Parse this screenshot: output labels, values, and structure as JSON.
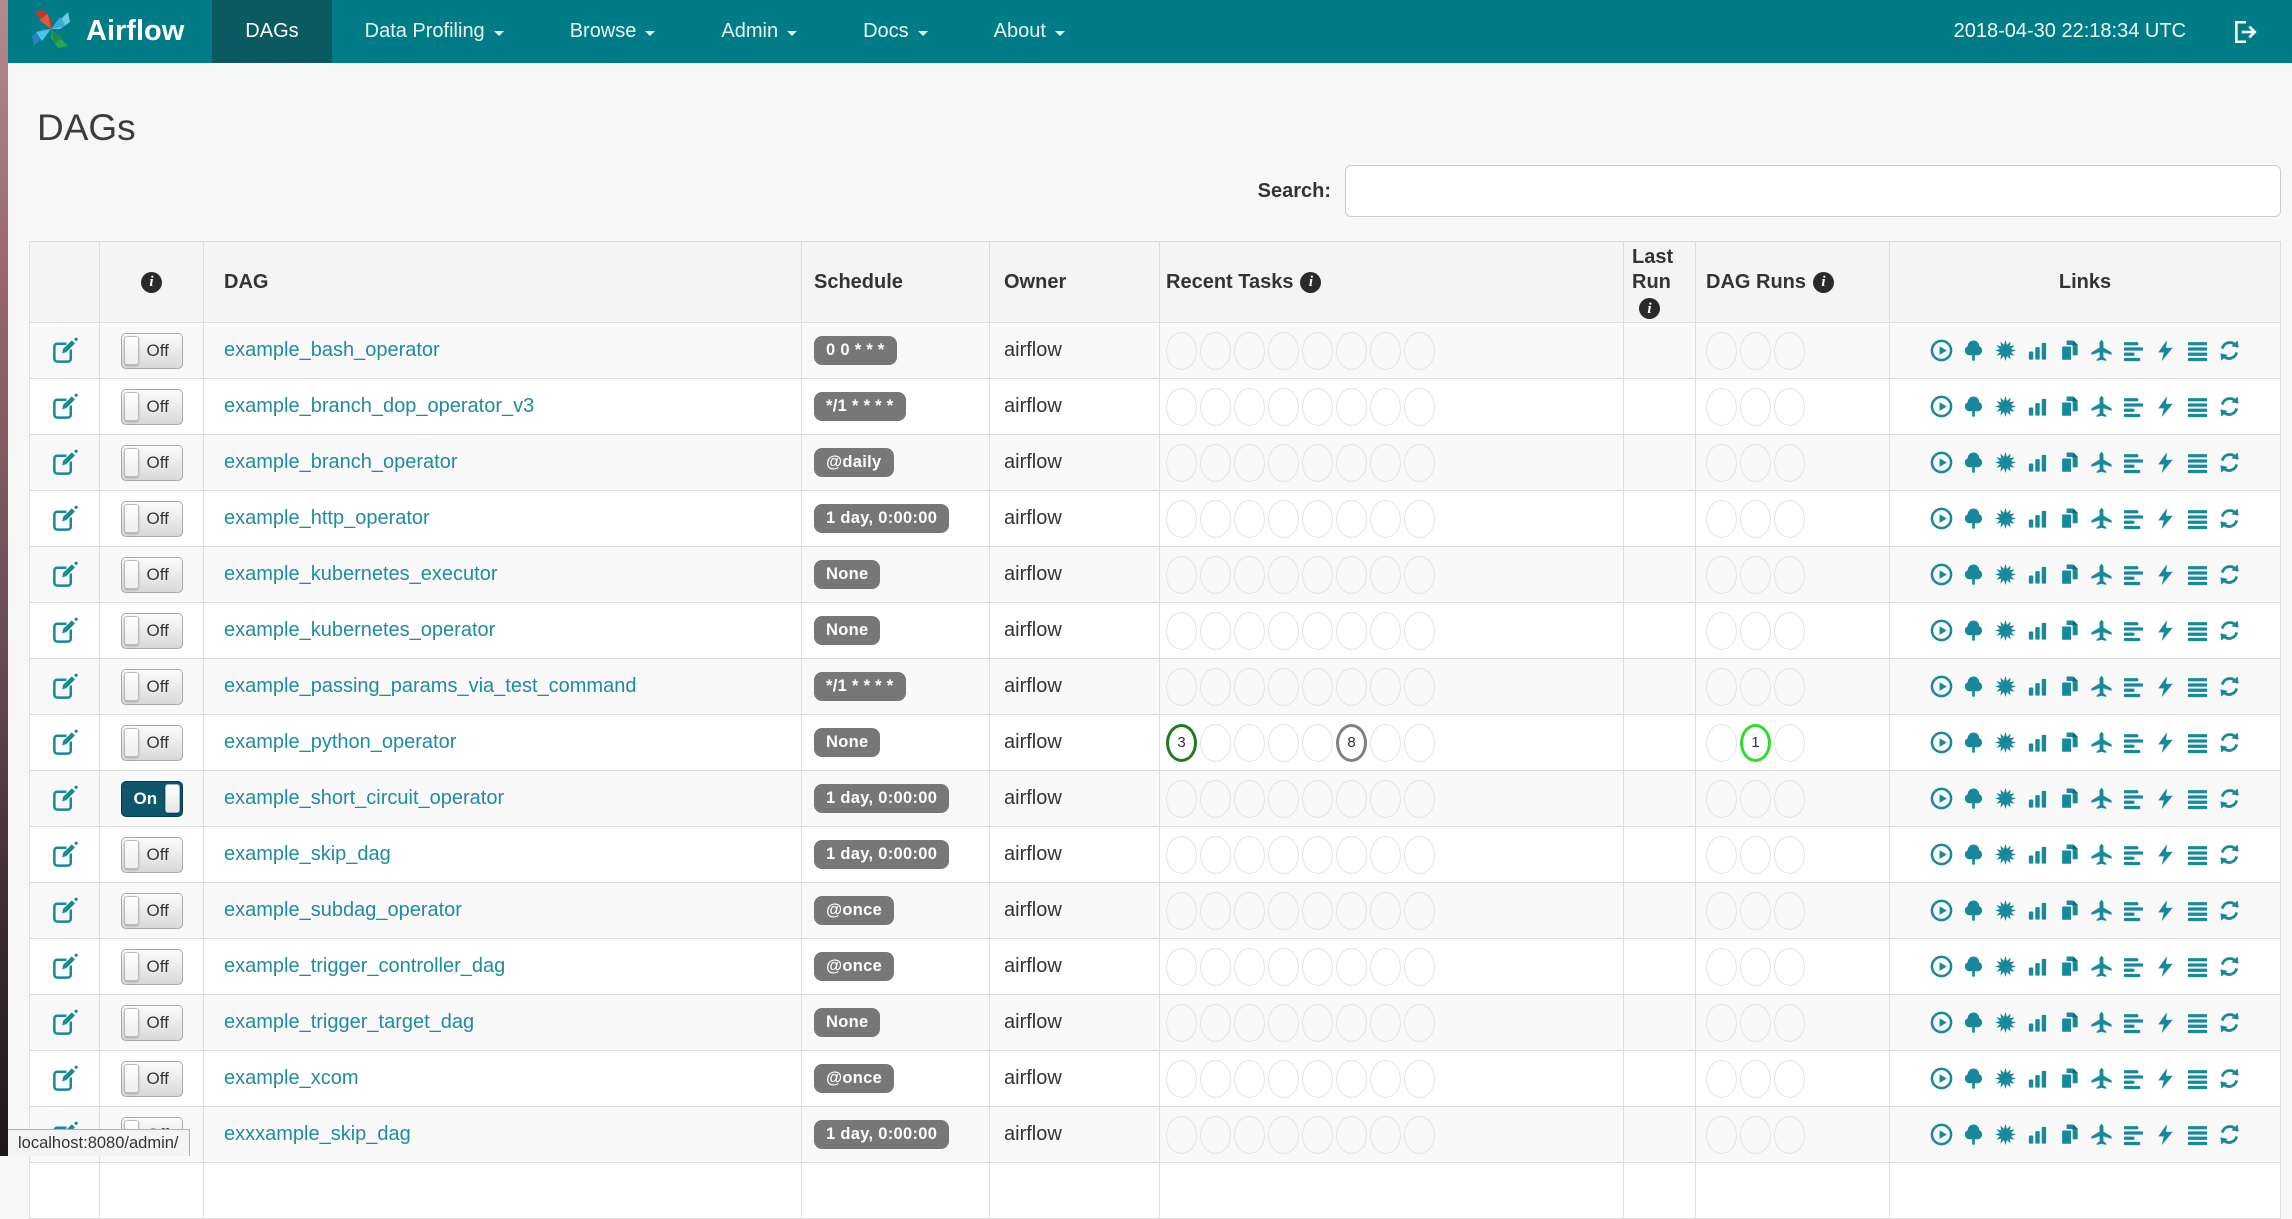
{
  "navbar": {
    "brand": "Airflow",
    "items": [
      {
        "label": "DAGs",
        "active": true,
        "dropdown": false
      },
      {
        "label": "Data Profiling",
        "active": false,
        "dropdown": true
      },
      {
        "label": "Browse",
        "active": false,
        "dropdown": true
      },
      {
        "label": "Admin",
        "active": false,
        "dropdown": true
      },
      {
        "label": "Docs",
        "active": false,
        "dropdown": true
      },
      {
        "label": "About",
        "active": false,
        "dropdown": true
      }
    ],
    "clock": "2018-04-30 22:18:34 UTC",
    "logout_icon": "sign-out-icon"
  },
  "page": {
    "title": "DAGs",
    "search_label": "Search:",
    "search_value": "",
    "status_bar_url": "localhost:8080/admin/"
  },
  "table": {
    "headers": {
      "edit": "",
      "info_glyph": "i",
      "dag": "DAG",
      "schedule": "Schedule",
      "owner": "Owner",
      "recent_tasks": "Recent Tasks",
      "last_run_line1": "Last",
      "last_run_line2": "Run",
      "dag_runs": "DAG Runs",
      "links": "Links"
    },
    "recent_task_slots": 8,
    "dag_run_slots": 3,
    "rows": [
      {
        "dag": "example_bash_operator",
        "toggle": "Off",
        "schedule": "0 0 * * *",
        "owner": "airflow",
        "recent_tasks": [],
        "dag_runs": []
      },
      {
        "dag": "example_branch_dop_operator_v3",
        "toggle": "Off",
        "schedule": "*/1 * * * *",
        "owner": "airflow",
        "recent_tasks": [],
        "dag_runs": []
      },
      {
        "dag": "example_branch_operator",
        "toggle": "Off",
        "schedule": "@daily",
        "owner": "airflow",
        "recent_tasks": [],
        "dag_runs": []
      },
      {
        "dag": "example_http_operator",
        "toggle": "Off",
        "schedule": "1 day, 0:00:00",
        "owner": "airflow",
        "recent_tasks": [],
        "dag_runs": []
      },
      {
        "dag": "example_kubernetes_executor",
        "toggle": "Off",
        "schedule": "None",
        "owner": "airflow",
        "recent_tasks": [],
        "dag_runs": []
      },
      {
        "dag": "example_kubernetes_operator",
        "toggle": "Off",
        "schedule": "None",
        "owner": "airflow",
        "recent_tasks": [],
        "dag_runs": []
      },
      {
        "dag": "example_passing_params_via_test_command",
        "toggle": "Off",
        "schedule": "*/1 * * * *",
        "owner": "airflow",
        "recent_tasks": [],
        "dag_runs": []
      },
      {
        "dag": "example_python_operator",
        "toggle": "Off",
        "schedule": "None",
        "owner": "airflow",
        "recent_tasks": [
          {
            "slot": 0,
            "count": "3",
            "color": "#217a21"
          },
          {
            "slot": 5,
            "count": "8",
            "color": "#808080"
          }
        ],
        "dag_runs": [
          {
            "slot": 1,
            "count": "1",
            "color": "#2ddc2d"
          }
        ]
      },
      {
        "dag": "example_short_circuit_operator",
        "toggle": "On",
        "schedule": "1 day, 0:00:00",
        "owner": "airflow",
        "recent_tasks": [],
        "dag_runs": []
      },
      {
        "dag": "example_skip_dag",
        "toggle": "Off",
        "schedule": "1 day, 0:00:00",
        "owner": "airflow",
        "recent_tasks": [],
        "dag_runs": []
      },
      {
        "dag": "example_subdag_operator",
        "toggle": "Off",
        "schedule": "@once",
        "owner": "airflow",
        "recent_tasks": [],
        "dag_runs": []
      },
      {
        "dag": "example_trigger_controller_dag",
        "toggle": "Off",
        "schedule": "@once",
        "owner": "airflow",
        "recent_tasks": [],
        "dag_runs": []
      },
      {
        "dag": "example_trigger_target_dag",
        "toggle": "Off",
        "schedule": "None",
        "owner": "airflow",
        "recent_tasks": [],
        "dag_runs": []
      },
      {
        "dag": "example_xcom",
        "toggle": "Off",
        "schedule": "@once",
        "owner": "airflow",
        "recent_tasks": [],
        "dag_runs": []
      },
      {
        "dag": "exxxample_skip_dag",
        "toggle": "Off",
        "schedule": "1 day, 0:00:00",
        "owner": "airflow",
        "recent_tasks": [],
        "dag_runs": []
      }
    ],
    "link_icons": [
      "trigger-dag-play-icon",
      "tree-view-icon",
      "graph-view-sunburst-icon",
      "task-duration-chart-icon",
      "task-tries-pages-icon",
      "landing-times-plane-icon",
      "gantt-chart-icon",
      "code-bolt-icon",
      "dag-details-list-icon",
      "refresh-icon"
    ]
  },
  "colors": {
    "navbar_bg": "#007c87",
    "navbar_active_bg": "#0b5961",
    "link_teal": "#1e8ca0",
    "icon_teal": "#17899b",
    "badge_grey": "#777777",
    "toggle_on_bg": "#0e566b",
    "circle_default_border": "#e3e3e3",
    "success_green": "#217a21",
    "queued_grey": "#808080",
    "running_lime": "#2ddc2d"
  }
}
